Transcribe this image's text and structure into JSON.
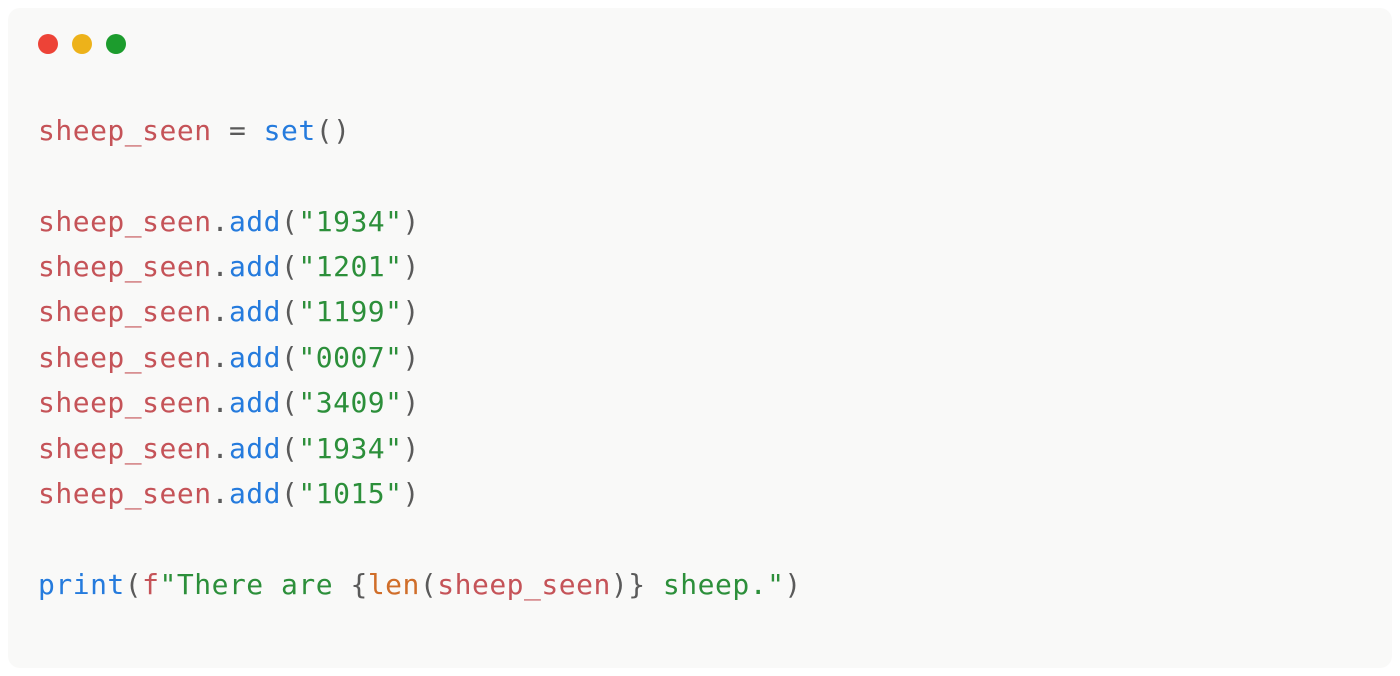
{
  "window": {
    "traffic_lights": [
      "red",
      "yellow",
      "green"
    ]
  },
  "code": {
    "var_name": "sheep_seen",
    "assign_op": "=",
    "set_call": "set",
    "paren_open": "(",
    "paren_close": ")",
    "dot": ".",
    "add_method": "add",
    "quote": "\"",
    "add_values": [
      "1934",
      "1201",
      "1199",
      "0007",
      "3409",
      "1934",
      "1015"
    ],
    "print_call": "print",
    "fstring_prefix": "f",
    "fstring_text1": "There are ",
    "brace_open": "{",
    "len_call": "len",
    "brace_close": "}",
    "fstring_text2": " sheep."
  }
}
